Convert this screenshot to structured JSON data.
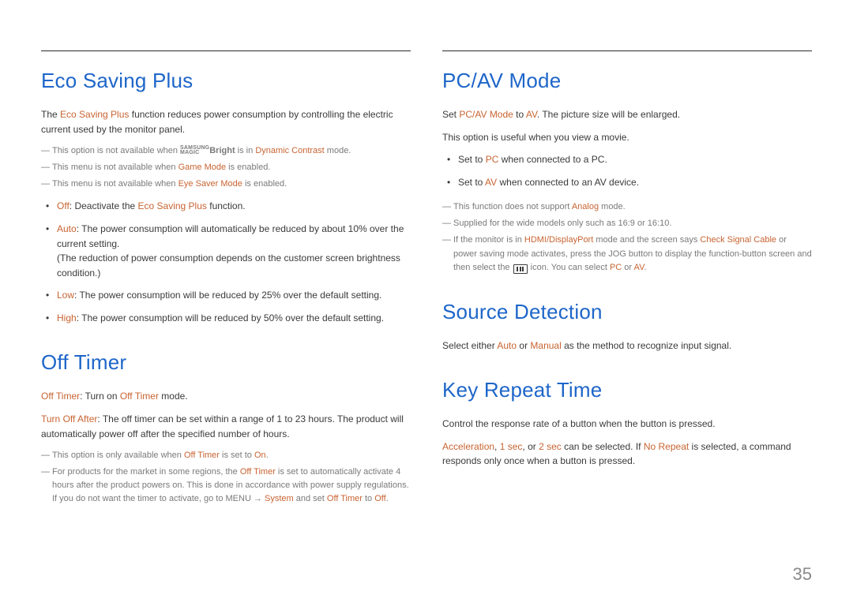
{
  "page_number": "35",
  "left": {
    "eco": {
      "title": "Eco Saving Plus",
      "intro_a": "The ",
      "intro_b": "Eco Saving Plus",
      "intro_c": " function reduces power consumption by controlling the electric current used by the monitor panel.",
      "notes": {
        "n1_a": "This option is not available when ",
        "n1_logo_top": "SAMSUNG",
        "n1_logo_bot": "MAGIC",
        "n1_b": "Bright",
        "n1_c": " is in ",
        "n1_d": "Dynamic Contrast",
        "n1_e": " mode.",
        "n2_a": "This menu is not available when ",
        "n2_b": "Game Mode",
        "n2_c": " is enabled.",
        "n3_a": "This menu is not available when ",
        "n3_b": "Eye Saver Mode",
        "n3_c": " is enabled."
      },
      "bullets": {
        "b1_a": "Off",
        "b1_b": ": Deactivate the ",
        "b1_c": "Eco Saving Plus",
        "b1_d": " function.",
        "b2_a": "Auto",
        "b2_b": ": The power consumption will automatically be reduced by about 10% over the current setting.",
        "b2_c": "(The reduction of power consumption depends on the customer screen brightness condition.)",
        "b3_a": "Low",
        "b3_b": ": The power consumption will be reduced by 25% over the default setting.",
        "b4_a": "High",
        "b4_b": ": The power consumption will be reduced by 50% over the default setting."
      }
    },
    "off": {
      "title": "Off Timer",
      "p1_a": "Off Timer",
      "p1_b": ": Turn on ",
      "p1_c": "Off Timer",
      "p1_d": " mode.",
      "p2_a": "Turn Off After",
      "p2_b": ": The off timer can be set within a range of 1 to 23 hours. The product will automatically power off after the specified number of hours.",
      "notes": {
        "n1_a": "This option is only available when ",
        "n1_b": "Off Timer",
        "n1_c": " is set to ",
        "n1_d": "On",
        "n1_e": ".",
        "n2_a": "For products for the market in some regions, the ",
        "n2_b": "Off Timer",
        "n2_c": " is set to automatically activate 4 hours after the product powers on. This is done in accordance with power supply regulations. If you do not want the timer to activate, go to MENU ",
        "n2_arrow": "→",
        "n2_d": " System",
        "n2_e": " and set ",
        "n2_f": "Off Timer",
        "n2_g": " to ",
        "n2_h": "Off",
        "n2_i": "."
      }
    }
  },
  "right": {
    "pcav": {
      "title": "PC/AV Mode",
      "p1_a": "Set ",
      "p1_b": "PC/AV Mode",
      "p1_c": " to ",
      "p1_d": "AV",
      "p1_e": ". The picture size will be enlarged.",
      "p2": "This option is useful when you view a movie.",
      "bullets": {
        "b1_a": "Set to ",
        "b1_b": "PC",
        "b1_c": " when connected to a PC.",
        "b2_a": "Set to ",
        "b2_b": "AV",
        "b2_c": " when connected to an AV device."
      },
      "notes": {
        "n1_a": "This function does not support ",
        "n1_b": "Analog",
        "n1_c": " mode.",
        "n2": "Supplied for the wide models only such as 16:9 or 16:10.",
        "n3_a": "If the monitor is in ",
        "n3_b": "HDMI/DisplayPort",
        "n3_c": " mode and the screen says ",
        "n3_d": "Check Signal Cable",
        "n3_e": " or power saving mode activates, press the JOG button to display the function-button screen and then select the ",
        "n3_f": " icon. You can select ",
        "n3_g": "PC",
        "n3_h": " or ",
        "n3_i": "AV",
        "n3_j": "."
      }
    },
    "src": {
      "title": "Source Detection",
      "p1_a": "Select either ",
      "p1_b": "Auto",
      "p1_c": " or ",
      "p1_d": "Manual",
      "p1_e": " as the method to recognize input signal."
    },
    "key": {
      "title": "Key Repeat Time",
      "p1": "Control the response rate of a button when the button is pressed.",
      "p2_a": "Acceleration",
      "p2_b": ", ",
      "p2_c": "1 sec",
      "p2_d": ", or ",
      "p2_e": "2 sec",
      "p2_f": " can be selected. If ",
      "p2_g": "No Repeat",
      "p2_h": " is selected, a command responds only once when a button is pressed."
    }
  }
}
